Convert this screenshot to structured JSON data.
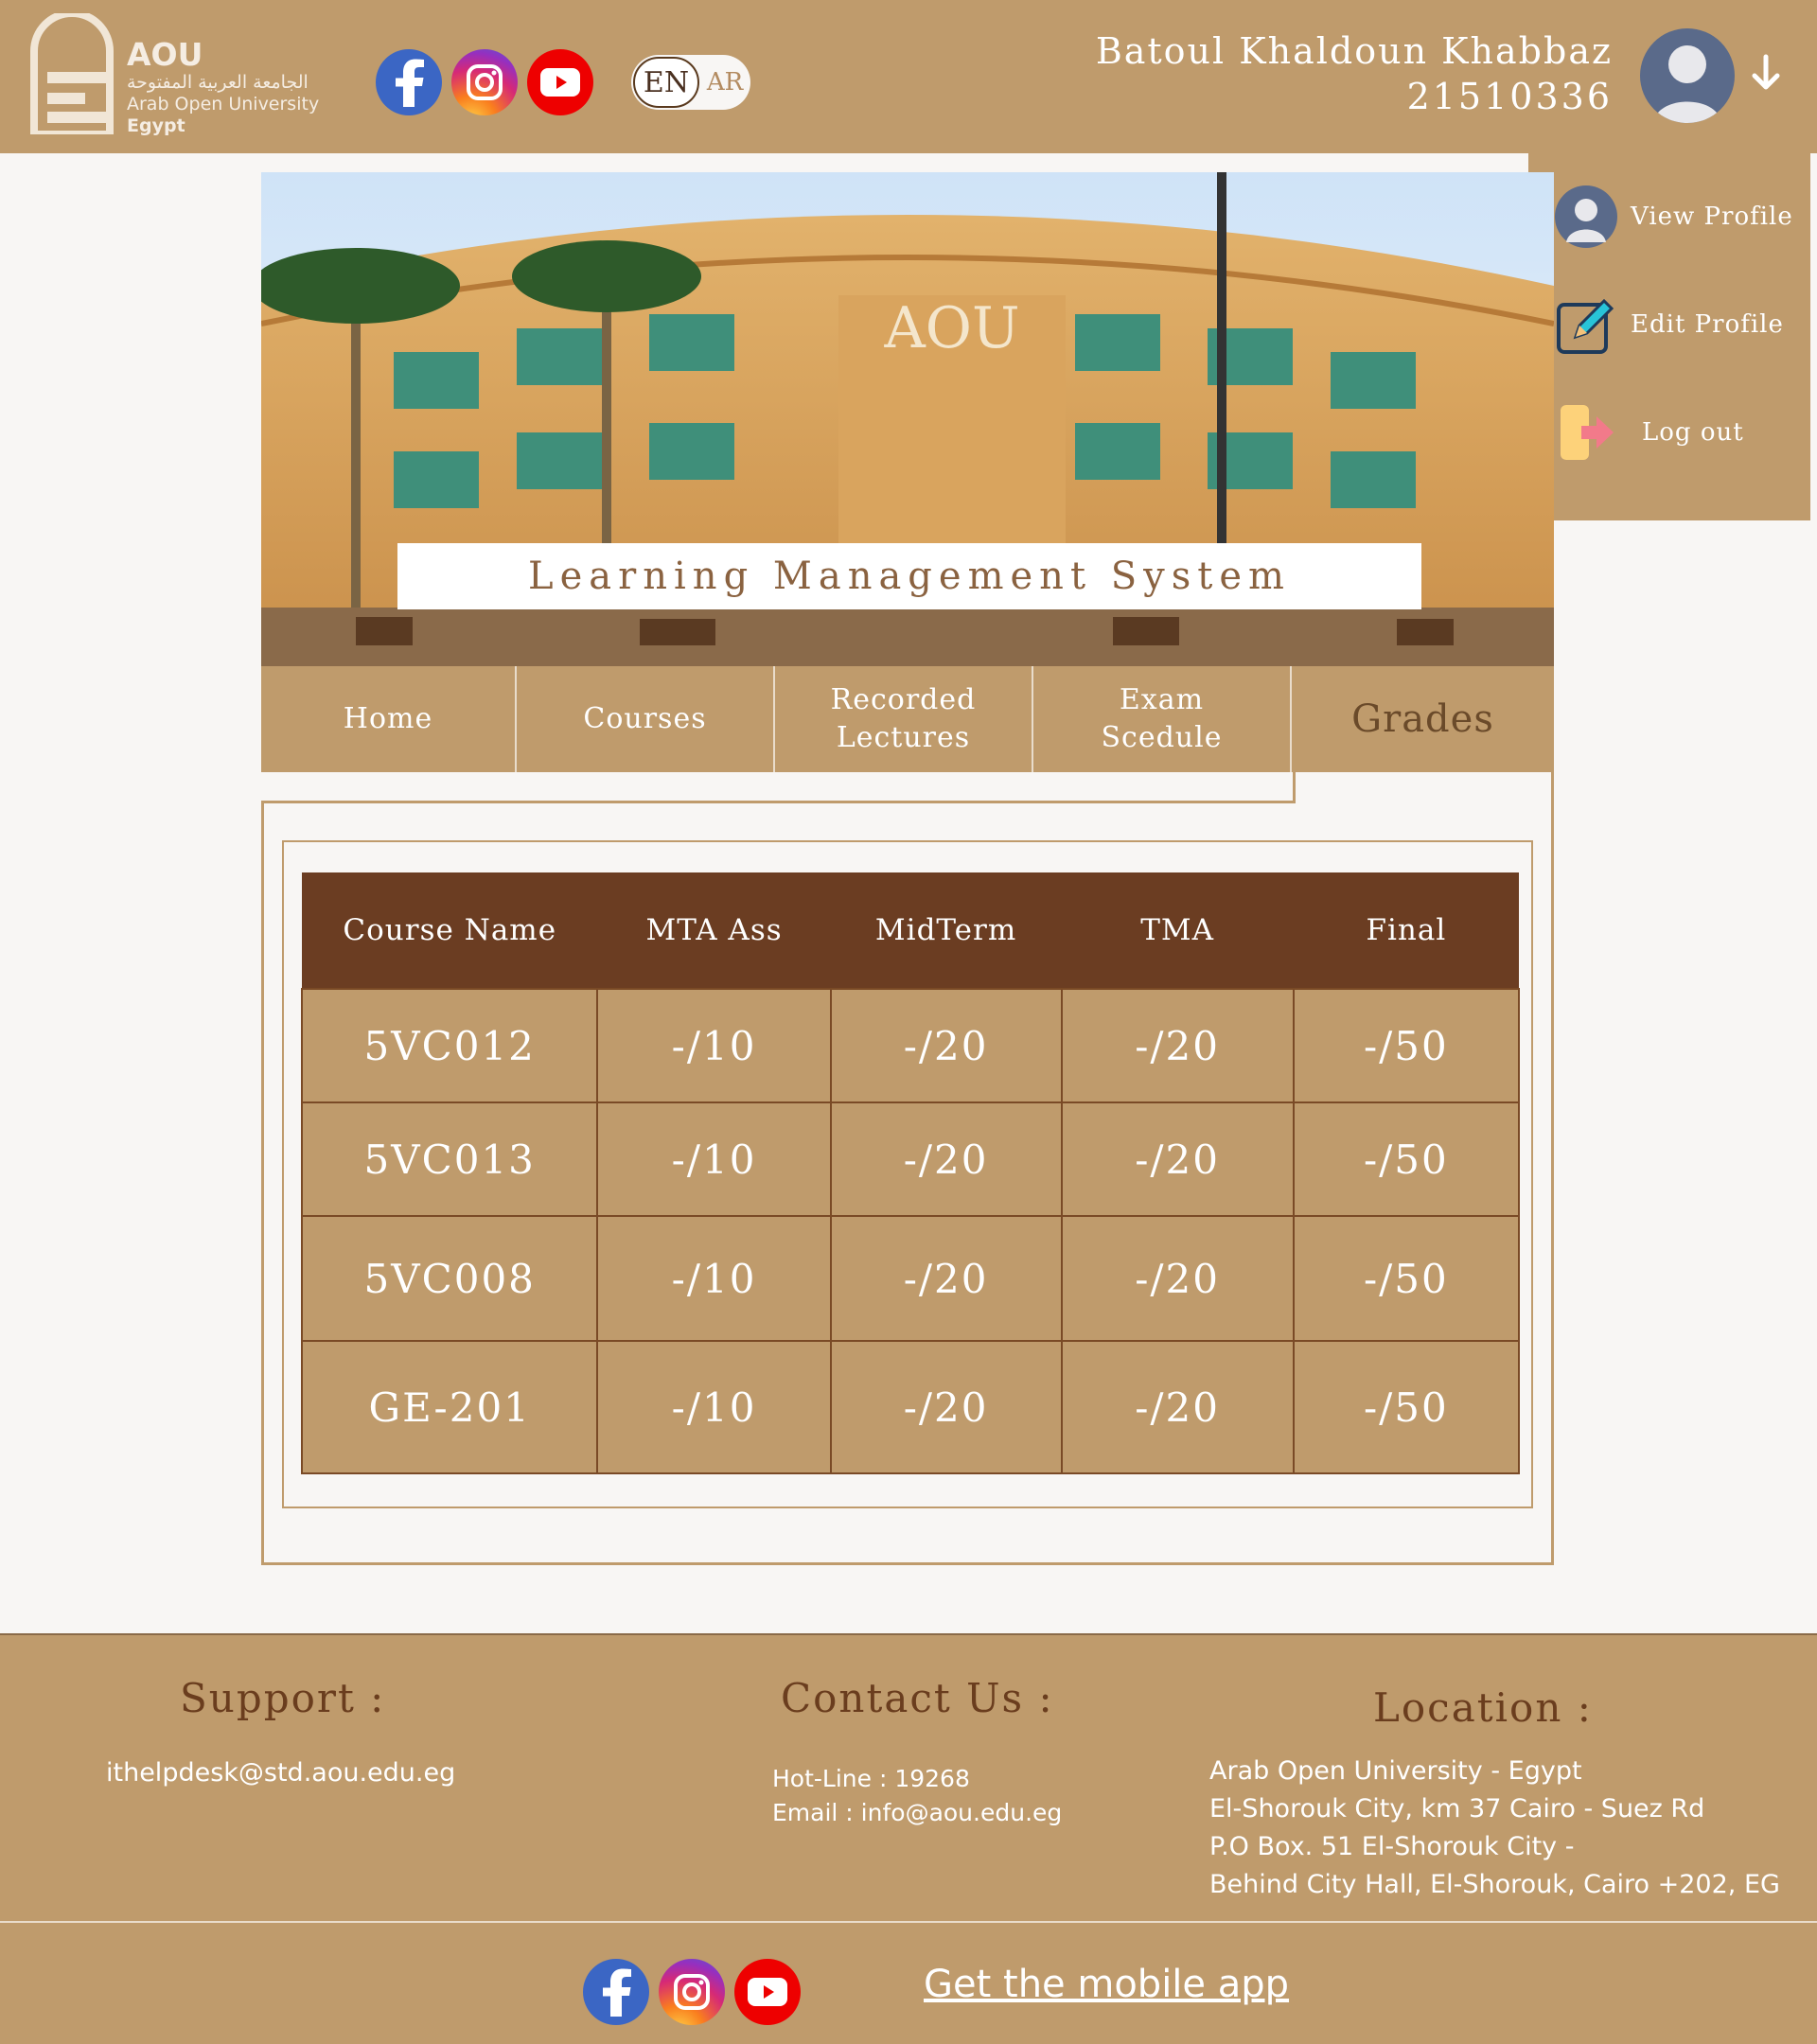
{
  "header": {
    "logo": {
      "abbr": "AOU",
      "arabic": "الجامعة العربية المفتوحة",
      "name": "Arab Open University",
      "country": "Egypt"
    },
    "lang": {
      "en": "EN",
      "ar": "AR"
    },
    "user": {
      "name": "Batoul Khaldoun Khabbaz",
      "id": "21510336"
    }
  },
  "dropdown": {
    "view_profile": "View Profile",
    "edit_profile": "Edit Profile",
    "logout": "Log out"
  },
  "banner": {
    "sign": "AOU",
    "title": "Learning Management System"
  },
  "nav": {
    "home": "Home",
    "courses": "Courses",
    "recorded_1": "Recorded",
    "recorded_2": "Lectures",
    "exam_1": "Exam",
    "exam_2": "Scedule",
    "grades": "Grades"
  },
  "grades": {
    "headers": [
      "Course Name",
      "MTA Ass",
      "MidTerm",
      "TMA",
      "Final"
    ],
    "rows": [
      [
        "5VC012",
        "-/10",
        "-/20",
        "-/20",
        "-/50"
      ],
      [
        "5VC013",
        "-/10",
        "-/20",
        "-/20",
        "-/50"
      ],
      [
        "5VC008",
        "-/10",
        "-/20",
        "-/20",
        "-/50"
      ],
      [
        "GE-201",
        "-/10",
        "-/20",
        "-/20",
        "-/50"
      ]
    ]
  },
  "footer": {
    "support_title": "Support :",
    "support_email": "ithelpdesk@std.aou.edu.eg",
    "contact_title": "Contact Us :",
    "hotline": "Hot-Line : 19268",
    "email": "Email : info@aou.edu.eg",
    "location_title": "Location :",
    "loc1": "Arab Open University - Egypt",
    "loc2": "El-Shorouk City, km 37 Cairo - Suez Rd",
    "loc3": "P.O Box. 51 El-Shorouk City -",
    "loc4": "Behind City Hall, El-Shorouk, Cairo +202, EG",
    "app_link": "Get the mobile app"
  },
  "icons": [
    "facebook-icon",
    "instagram-icon",
    "youtube-icon",
    "user-avatar-icon",
    "arrow-down-icon",
    "edit-icon",
    "logout-icon"
  ],
  "colors": {
    "primary": "#bf9b6c",
    "dark": "#6b3d22",
    "background": "#f8f6f4"
  }
}
